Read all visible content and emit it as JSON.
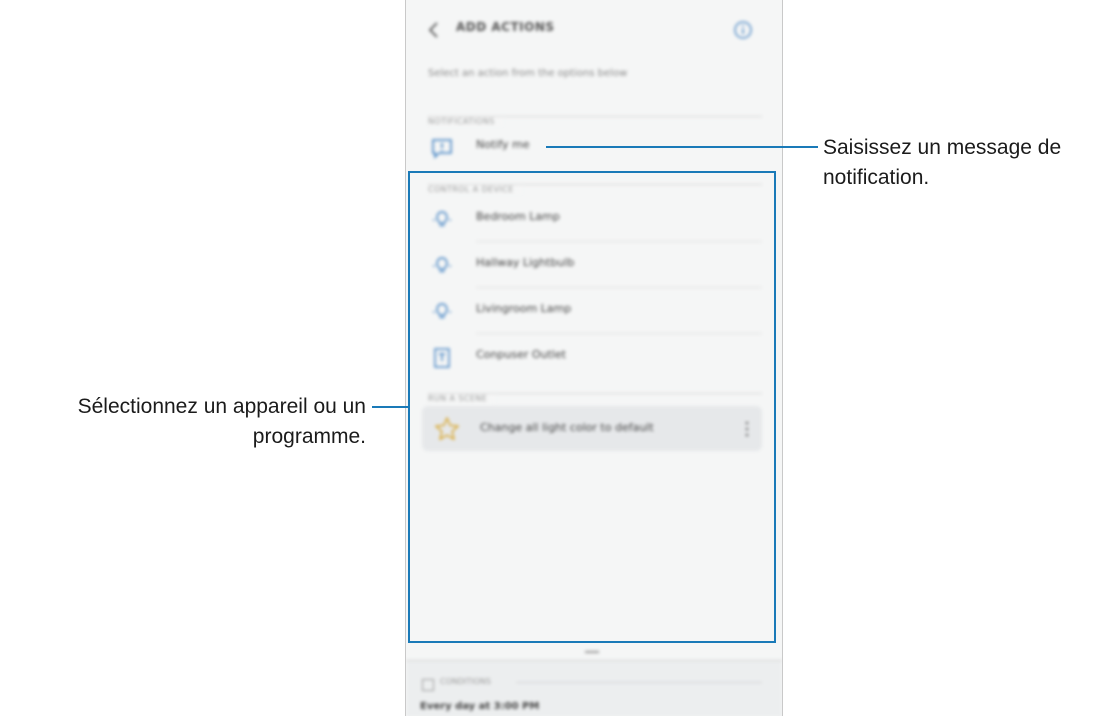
{
  "screen": {
    "header": {
      "title": "ADD ACTIONS",
      "back_icon": "chevron-left-icon",
      "info_icon": "info-icon"
    },
    "subtitle": "Select an action from the options below",
    "sections": {
      "notifications": "NOTIFICATIONS",
      "control_device": "CONTROL A DEVICE",
      "run_scene": "RUN A SCENE",
      "conditions": "CONDITIONS"
    },
    "notify_item": {
      "label": "Notify me",
      "icon": "message-alert-icon"
    },
    "devices": [
      {
        "label": "Bedroom Lamp",
        "icon": "lightbulb-icon"
      },
      {
        "label": "Hallway Lightbulb",
        "icon": "lightbulb-icon"
      },
      {
        "label": "Livingroom Lamp",
        "icon": "lightbulb-icon"
      },
      {
        "label": "Conpuser Outlet",
        "icon": "outlet-icon"
      }
    ],
    "scene_item": {
      "label": "Change all light color to default",
      "icon": "star-icon"
    },
    "condition_time": "Every day at 3:00 PM"
  },
  "callouts": {
    "right": {
      "line1": "Saisissez un message de",
      "line2": "notification."
    },
    "left": {
      "line1": "Sélectionnez un appareil ou un",
      "line2": "programme."
    }
  },
  "colors": {
    "accent": "#1a7ab8",
    "icon_blue": "#3d7fc1",
    "star_gold": "#d8a833"
  }
}
